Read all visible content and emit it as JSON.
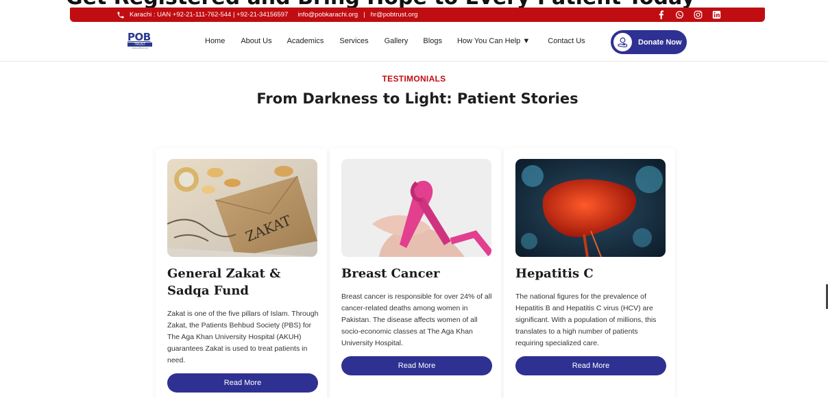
{
  "clipped_heading": "Get Registered and Bring Hope to Every Patient Today",
  "topbar": {
    "info": "Karachi : UAN +92-21-111-762-544 | +92-21-34156597",
    "email1": "info@pobkarachi.org",
    "separator": "|",
    "email2": "hr@pobtrust.org",
    "social_icons": [
      "facebook-icon",
      "whatsapp-icon",
      "instagram-icon",
      "linkedin-icon"
    ]
  },
  "logo": {
    "line1": "POB",
    "line2": "TRUST",
    "line3": "www.pobtrust.org"
  },
  "nav": {
    "items": [
      "Home",
      "About Us",
      "Academics",
      "Services",
      "Gallery",
      "Blogs",
      "How You Can Help ▼",
      "Contact Us"
    ],
    "donate_label": "Donate Now"
  },
  "section": {
    "eyebrow": "TESTIMONIALS",
    "title": "From Darkness to Light: Patient Stories"
  },
  "cards": [
    {
      "title": "General Zakat & Sadqa Fund",
      "text": "Zakat is one of the five pillars of Islam. Through Zakat, the Patients Behbud Society (PBS) for The Aga Khan University Hospital (AKUH) guarantees Zakat is used to treat patients in need.",
      "button": "Read More",
      "image_word": "ZAKAT"
    },
    {
      "title": "Breast Cancer",
      "text": "Breast cancer is responsible for over 24% of all cancer-related deaths among women in Pakistan. The disease affects women of all socio-economic classes at The Aga Khan University Hospital.",
      "button": "Read More"
    },
    {
      "title": "Hepatitis C",
      "text": "The national figures for the prevalence of Hepatitis B and Hepatitis C virus (HCV) are significant. With a population of millions, this translates to a high number of patients requiring specialized care.",
      "button": "Read More"
    }
  ],
  "colors": {
    "brand_red": "#c00d12",
    "brand_blue": "#2e3192"
  }
}
